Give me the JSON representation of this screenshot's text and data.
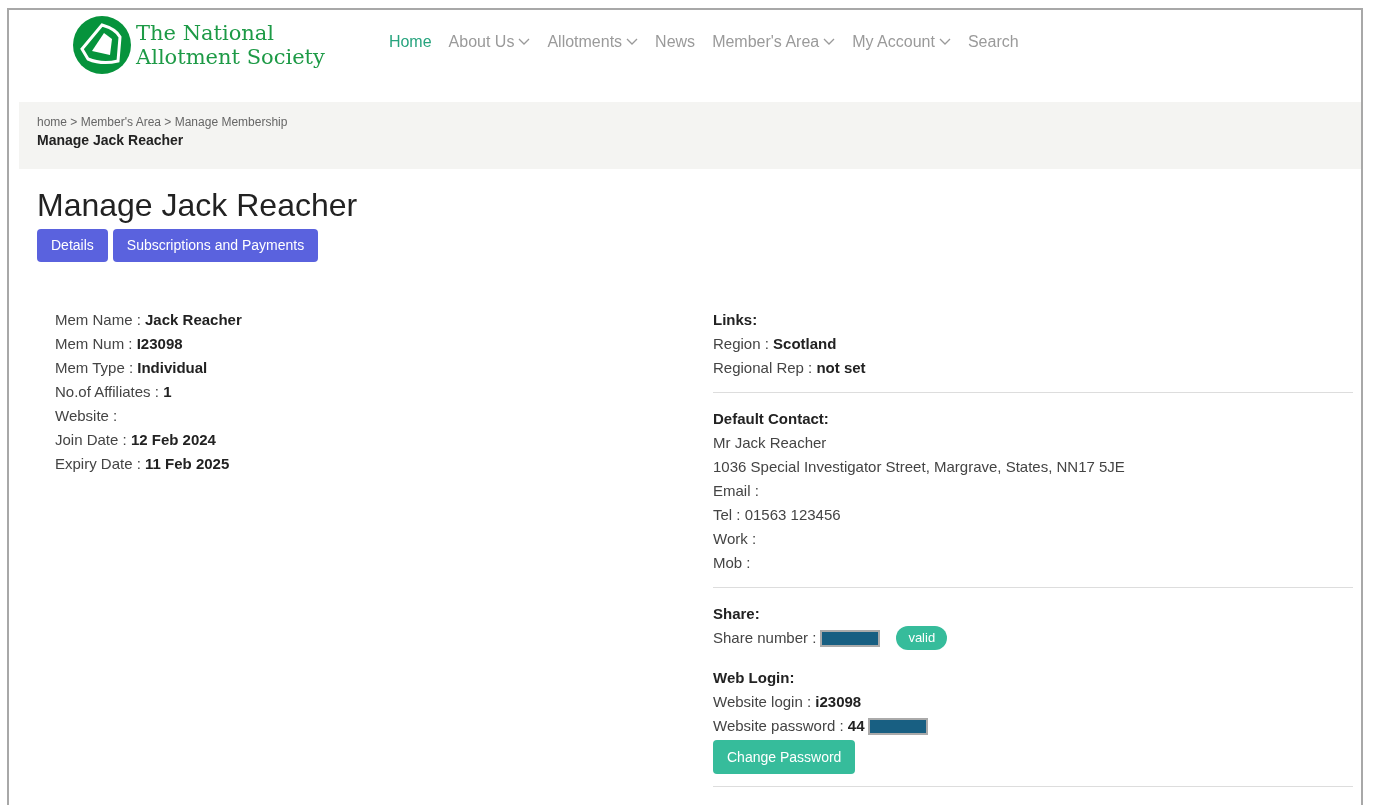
{
  "logo": {
    "line1": "The National",
    "line2": "Allotment Society"
  },
  "nav": [
    {
      "label": "Home",
      "selected": true,
      "dropdown": false
    },
    {
      "label": "About Us",
      "selected": false,
      "dropdown": true
    },
    {
      "label": "Allotments",
      "selected": false,
      "dropdown": true
    },
    {
      "label": "News",
      "selected": false,
      "dropdown": false
    },
    {
      "label": "Member's Area",
      "selected": false,
      "dropdown": true
    },
    {
      "label": "My Account",
      "selected": false,
      "dropdown": true
    },
    {
      "label": "Search",
      "selected": false,
      "dropdown": false
    }
  ],
  "breadcrumb": {
    "trail": "home > Member's Area > Manage Membership",
    "current": "Manage Jack Reacher"
  },
  "title": "Manage Jack Reacher",
  "tabs": [
    {
      "label": "Details"
    },
    {
      "label": "Subscriptions and Payments"
    }
  ],
  "member_details": [
    {
      "label": "Mem Name :",
      "value": "Jack Reacher"
    },
    {
      "label": "Mem Num :",
      "value": "I23098"
    },
    {
      "label": "Mem Type :",
      "value": "Individual"
    },
    {
      "label": "No.of Affiliates :",
      "value": "1"
    },
    {
      "label": "Website :"
    },
    {
      "label": "Join Date :",
      "value": "12 Feb 2024"
    },
    {
      "label": "Expiry Date :",
      "value": "11 Feb 2025"
    }
  ],
  "sections": [
    {
      "heading": "Links:",
      "lines": [
        {
          "label": "Region :",
          "value": "Scotland"
        },
        {
          "label": "Regional Rep :",
          "value": "not set"
        }
      ]
    },
    {
      "heading": "Default Contact:",
      "lines": [
        {
          "label": "Mr Jack Reacher"
        },
        {
          "label": "1036 Special Investigator Street, Margrave, States, NN17 5JE"
        },
        {
          "label": "Email :"
        },
        {
          "label": "Tel : 01563 123456"
        },
        {
          "label": "Work :"
        },
        {
          "label": "Mob :"
        }
      ]
    },
    {
      "heading": "Share:",
      "lines": [
        {
          "label": "Share number :",
          "redacted": true,
          "badge": "valid"
        }
      ],
      "subheading": "Web Login:",
      "sublines": [
        {
          "label": "Website login :",
          "value": "i23098"
        },
        {
          "label": "Website password :",
          "value": "44",
          "redacted": true
        }
      ],
      "button": "Change Password"
    }
  ]
}
